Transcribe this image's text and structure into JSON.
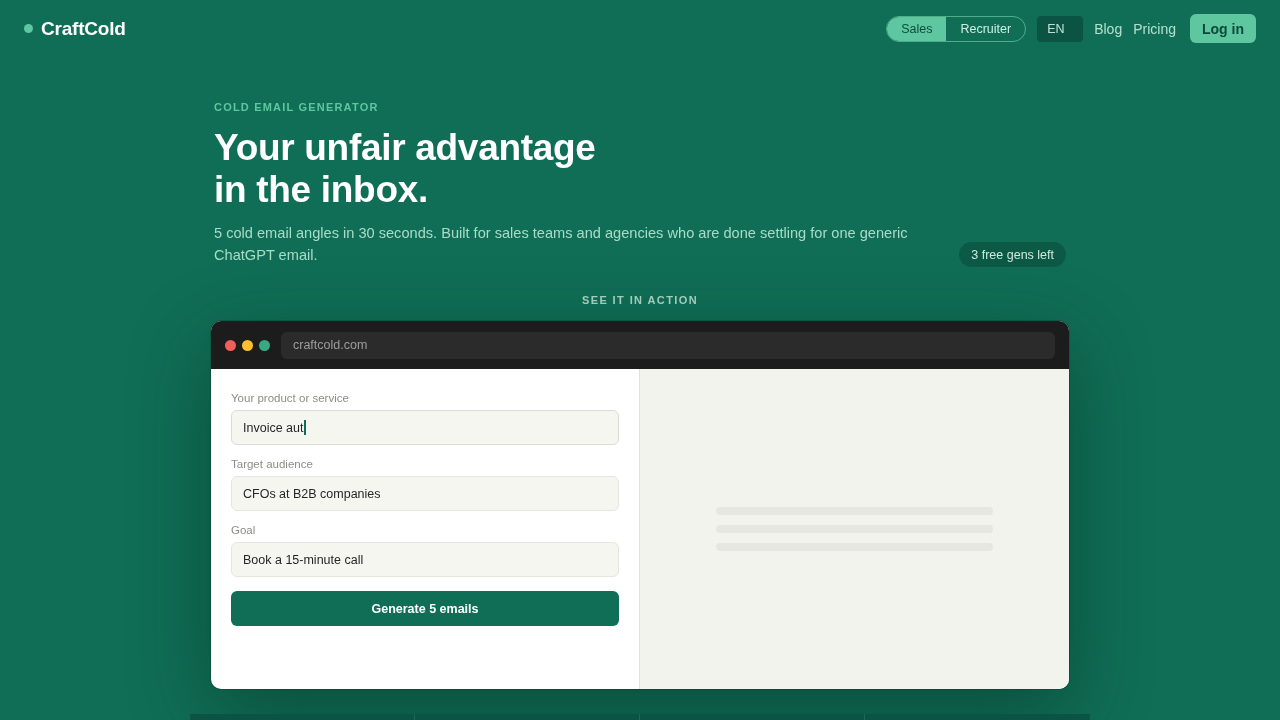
{
  "header": {
    "logo": "CraftCold",
    "mode_toggle": [
      {
        "label": "Sales",
        "selected": true
      },
      {
        "label": "Recruiter",
        "selected": false
      }
    ],
    "language": "EN",
    "nav_links": [
      "Blog",
      "Pricing"
    ],
    "login_button": "Log in"
  },
  "hero": {
    "eyebrow": "COLD EMAIL GENERATOR",
    "title_lines": [
      "Your unfair advantage",
      "in the inbox."
    ],
    "subtitle": "5 cold email angles in 30 seconds. Built for sales teams and agencies who are done settling for one generic ChatGPT email.",
    "credits_badge": "3 free gens left"
  },
  "demo": {
    "section_label": "SEE IT IN ACTION",
    "browser": {
      "url": "craftcold.com"
    },
    "form": {
      "fields": [
        {
          "label": "Your product or service",
          "value": "Invoice aut",
          "focused": true
        },
        {
          "label": "Target audience",
          "value": "CFOs at B2B companies",
          "focused": false
        },
        {
          "label": "Goal",
          "value": "Book a 15-minute call",
          "focused": false
        }
      ],
      "submit_button": "Generate 5 emails"
    },
    "preview": {
      "loading": true
    }
  }
}
